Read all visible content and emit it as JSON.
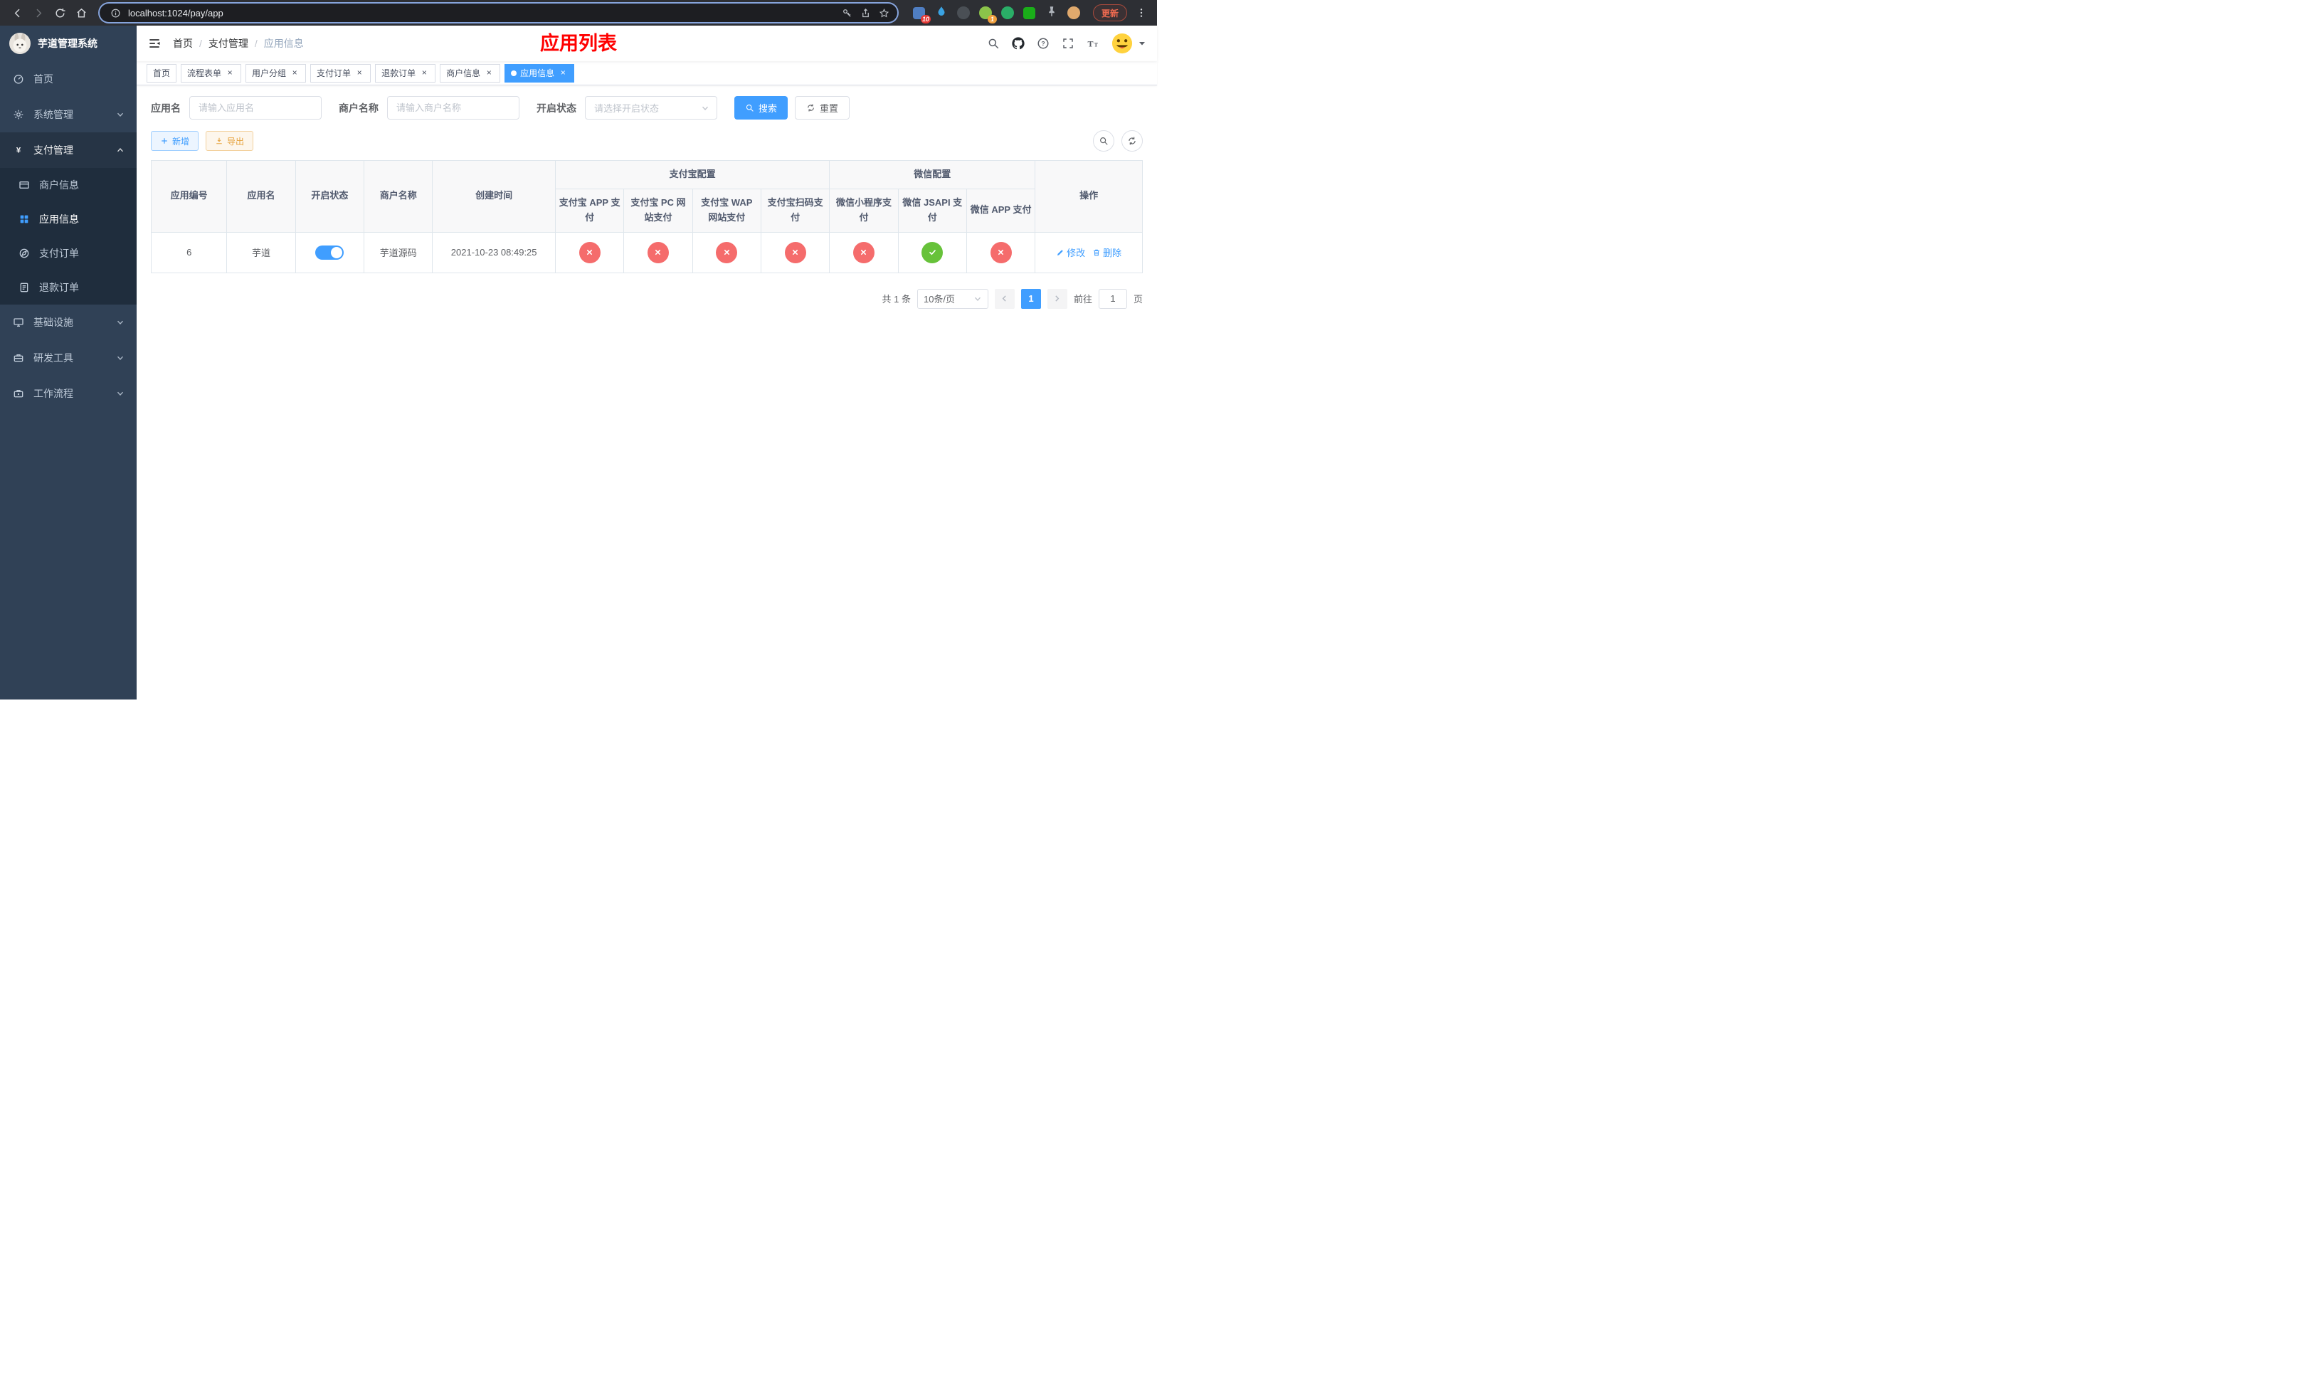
{
  "browser": {
    "url": "localhost:1024/pay/app",
    "update_label": "更新",
    "extensions": [
      {
        "name": "extension-pixel-blue",
        "shape": "square",
        "color": "#4f7ec2",
        "badge": "10",
        "badge_color": "#e53935"
      },
      {
        "name": "extension-droplet",
        "shape": "droplet",
        "color": "#3aa3e3"
      },
      {
        "name": "extension-dark-globe",
        "shape": "circle",
        "color": "#4a4f55"
      },
      {
        "name": "extension-avatar-green",
        "shape": "circle",
        "color": "#8bc34a",
        "badge": "1",
        "badge_color": "#ef9f3c"
      },
      {
        "name": "extension-wechat",
        "shape": "circle",
        "color": "#2aae67"
      },
      {
        "name": "extension-chat-square",
        "shape": "square",
        "color": "#1aad19"
      },
      {
        "name": "extension-pushpin",
        "shape": "pin",
        "color": "#aeb4bb"
      },
      {
        "name": "extension-emoji-face",
        "shape": "circle",
        "color": "#e0a96d"
      }
    ]
  },
  "sidebar": {
    "logo_title": "芋道管理系统",
    "items": [
      {
        "key": "home",
        "label": "首页",
        "icon": "dashboard-icon",
        "expandable": false
      },
      {
        "key": "system-management",
        "label": "系统管理",
        "icon": "gear-icon",
        "expandable": true
      },
      {
        "key": "payment-management",
        "label": "支付管理",
        "icon": "yen-icon",
        "expandable": true,
        "expanded": true,
        "children": [
          {
            "key": "merchant-info",
            "label": "商户信息",
            "icon": "card-icon",
            "active": false
          },
          {
            "key": "app-info",
            "label": "应用信息",
            "icon": "grid-icon",
            "active": true
          },
          {
            "key": "payment-orders",
            "label": "支付订单",
            "icon": "order-icon",
            "active": false
          },
          {
            "key": "refund-orders",
            "label": "退款订单",
            "icon": "doc-icon",
            "active": false
          }
        ]
      },
      {
        "key": "infrastructure",
        "label": "基础设施",
        "icon": "monitor-icon",
        "expandable": true
      },
      {
        "key": "dev-tools",
        "label": "研发工具",
        "icon": "toolbox-icon",
        "expandable": true
      },
      {
        "key": "workflow",
        "label": "工作流程",
        "icon": "workflow-icon",
        "expandable": true
      }
    ]
  },
  "header": {
    "breadcrumb": [
      "首页",
      "支付管理",
      "应用信息"
    ],
    "page_title": "应用列表"
  },
  "tabs": [
    {
      "key": "home",
      "label": "首页",
      "closable": false,
      "active": false
    },
    {
      "key": "process-form",
      "label": "流程表单",
      "closable": true,
      "active": false
    },
    {
      "key": "user-group",
      "label": "用户分组",
      "closable": true,
      "active": false
    },
    {
      "key": "payment-orders",
      "label": "支付订单",
      "closable": true,
      "active": false
    },
    {
      "key": "refund-orders",
      "label": "退款订单",
      "closable": true,
      "active": false
    },
    {
      "key": "merchant-info",
      "label": "商户信息",
      "closable": true,
      "active": false
    },
    {
      "key": "app-info",
      "label": "应用信息",
      "closable": true,
      "active": true
    }
  ],
  "filters": {
    "app_name_label": "应用名",
    "app_name_placeholder": "请输入应用名",
    "merchant_name_label": "商户名称",
    "merchant_name_placeholder": "请输入商户名称",
    "status_label": "开启状态",
    "status_placeholder": "请选择开启状态",
    "search_label": "搜索",
    "reset_label": "重置"
  },
  "toolbar": {
    "add_label": "新增",
    "export_label": "导出"
  },
  "table": {
    "columns_left": [
      "应用编号",
      "应用名",
      "开启状态",
      "商户名称",
      "创建时间"
    ],
    "groups": [
      {
        "label": "支付宝配置",
        "children": [
          "支付宝 APP 支付",
          "支付宝 PC 网站支付",
          "支付宝 WAP 网站支付",
          "支付宝扫码支付"
        ]
      },
      {
        "label": "微信配置",
        "children": [
          "微信小程序支付",
          "微信 JSAPI 支付",
          "微信 APP 支付"
        ]
      }
    ],
    "columns_right": [
      "操作"
    ],
    "rows": [
      {
        "id": "6",
        "name": "芋道",
        "enabled": true,
        "merchant": "芋道源码",
        "created_at": "2021-10-23 08:49:25",
        "configs": [
          false,
          false,
          false,
          false,
          false,
          true,
          false
        ],
        "edit_label": "修改",
        "delete_label": "删除"
      }
    ]
  },
  "pagination": {
    "total_label": "共 1 条",
    "page_size": "10条/页",
    "current_page": "1",
    "goto_label": "前往",
    "goto_value": "1",
    "page_suffix": "页"
  },
  "colors": {
    "primary": "#409EFF",
    "success": "#67C23A",
    "danger": "#F56C6C",
    "warning": "#E6A23C",
    "title_red": "#FF0000",
    "sidebar_bg": "#304156",
    "submenu_bg": "#1F2D3D"
  }
}
